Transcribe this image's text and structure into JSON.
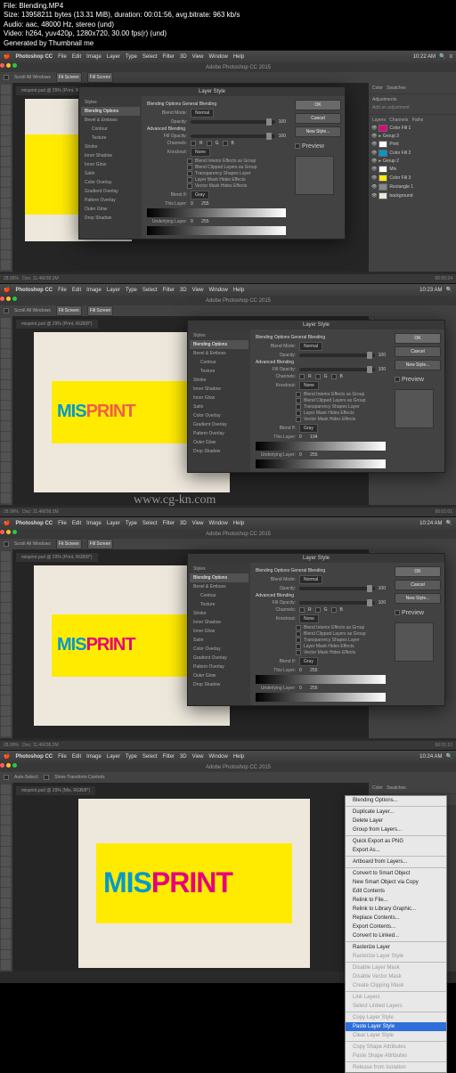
{
  "meta": {
    "file": "File: Blending.MP4",
    "size": "Size: 13958211 bytes (13.31 MiB), duration: 00:01:56, avg.bitrate: 963 kb/s",
    "audio": "Audio: aac, 48000 Hz, stereo (und)",
    "video": "Video: h264, yuv420p, 1280x720, 30.00 fps(r) (und)",
    "gen": "Generated by Thumbnail me"
  },
  "mac": {
    "app": "Photoshop CC",
    "menus": [
      "File",
      "Edit",
      "Image",
      "Layer",
      "Type",
      "Select",
      "Filter",
      "3D",
      "View",
      "Window",
      "Help"
    ],
    "time1": "10:22 AM",
    "time2": "10:23 AM",
    "time3": "10:24 AM",
    "time4": "10:24 AM"
  },
  "ps": {
    "title": "Adobe Photoshop CC 2015"
  },
  "options": {
    "scroll": "Scroll All Windows",
    "fit": "Fit Screen",
    "fill": "Fill Screen",
    "autoselect": "Auto-Select:",
    "showtransform": "Show Transform Controls"
  },
  "doc": {
    "tab1": "misprint.psd @ 29% (Print, RGB/8*)",
    "tab2": "misprint.psd @ 29% (Print, RGB/8*)",
    "tab3": "misprint.psd @ 29% (Print, RGB/8*)",
    "tab4": "misprint.psd @ 29% (Mis, RGB/8*)"
  },
  "canvas": {
    "mis": "MIS",
    "print": "PRINT",
    "misprint_m": "MIS",
    "misprint_p": "PRINT"
  },
  "dialog": {
    "title": "Layer Style",
    "styles_header": "Styles",
    "items": {
      "blending": "Blending Options",
      "bevel": "Bevel & Emboss",
      "contour": "Contour",
      "texture": "Texture",
      "stroke": "Stroke",
      "innershadow": "Inner Shadow",
      "innerglow": "Inner Glow",
      "satin": "Satin",
      "coloroverlay": "Color Overlay",
      "gradientoverlay": "Gradient Overlay",
      "patternoverlay": "Pattern Overlay",
      "outerglow": "Outer Glow",
      "dropshadow": "Drop Shadow"
    },
    "section": {
      "general": "Blending Options\nGeneral Blending",
      "advanced": "Advanced Blending"
    },
    "fields": {
      "blendmode": "Blend Mode:",
      "blendmode_val": "Normal",
      "opacity": "Opacity:",
      "opacity_val": "100",
      "fillopacity": "Fill Opacity:",
      "fillopacity_val": "100",
      "channels": "Channels:",
      "ch_r": "R",
      "ch_g": "G",
      "ch_b": "B",
      "knockout": "Knockout:",
      "knockout_val": "None",
      "c1": "Blend Interior Effects as Group",
      "c2": "Blend Clipped Layers as Group",
      "c3": "Transparency Shapes Layer",
      "c4": "Layer Mask Hides Effects",
      "c5": "Vector Mask Hides Effects",
      "blendif": "Blend If:",
      "blendif_val": "Gray",
      "thislayer": "This Layer:",
      "thislayer_v1": "0",
      "thislayer_v2": "194",
      "underlying": "Underlying Layer:",
      "underlying_v1": "0",
      "underlying_v2": "255"
    },
    "buttons": {
      "ok": "OK",
      "cancel": "Cancel",
      "newstyle": "New Style...",
      "preview": "Preview"
    }
  },
  "panels": {
    "color": "Color",
    "swatches": "Swatches",
    "adjustments": "Adjustments",
    "addadj": "Add an adjustment",
    "layers": "Layers",
    "channels": "Channels",
    "paths": "Paths",
    "layer_items": {
      "colorfill1": "Color Fill 1",
      "group3": "Group 3",
      "print": "Print",
      "colorfill2": "Color Fill 2",
      "group2": "Group 2",
      "mis": "Mis",
      "colorfill3": "Color Fill 3",
      "rectangle1": "Rectangle 1",
      "background": "background"
    }
  },
  "status": {
    "zoom1": "28.99%",
    "docinfo": "Doc: 11.4M/38.3M",
    "ts1": "00:00:24",
    "ts2": "00:01:01",
    "ts3": "00:01:10"
  },
  "context": {
    "blending": "Blending Options...",
    "duplicate": "Duplicate Layer...",
    "delete": "Delete Layer",
    "group": "Group from Layers...",
    "quickpng": "Quick Export as PNG",
    "exportas": "Export As...",
    "artboard": "Artboard from Layers...",
    "smartobj": "Convert to Smart Object",
    "newsmartcopy": "New Smart Object via Copy",
    "editcontents": "Edit Contents",
    "relink": "Relink to File...",
    "relinklib": "Relink to Library Graphic...",
    "replace": "Replace Contents...",
    "exportcontents": "Export Contents...",
    "convertlinked": "Convert to Linked...",
    "rasterize": "Rasterize Layer",
    "rasterizestyle": "Rasterize Layer Style",
    "disablemask": "Disable Layer Mask",
    "disablevmask": "Disable Vector Mask",
    "createclip": "Create Clipping Mask",
    "linklayers": "Link Layers",
    "selectlinked": "Select Linked Layers",
    "copystyle": "Copy Layer Style",
    "pastestyle": "Paste Layer Style",
    "clearstyle": "Clear Layer Style",
    "copyshape": "Copy Shape Attributes",
    "pasteshape": "Paste Shape Attributes",
    "release": "Release from Isolation"
  },
  "watermark": "www.cg-kn.com"
}
